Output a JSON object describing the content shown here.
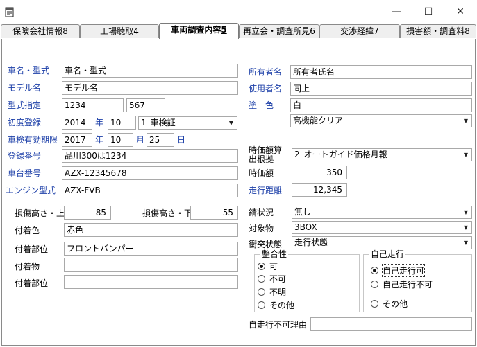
{
  "window": {
    "app_icon": "notepad-icon",
    "minimize_glyph": "—",
    "maximize_glyph": "☐",
    "close_glyph": "✕"
  },
  "tabs": [
    {
      "label": "保険会社情報",
      "key": "8"
    },
    {
      "label": "工場聴取",
      "key": "4"
    },
    {
      "label": "車両調査内容",
      "key": "5"
    },
    {
      "label": "再立会・調査所見",
      "key": "6"
    },
    {
      "label": "交渉経緯",
      "key": "7"
    },
    {
      "label": "損害額・調査料",
      "key": "8"
    }
  ],
  "left": {
    "car_name_label": "車名・型式",
    "car_name_value": "車名・型式",
    "model_label": "モデル名",
    "model_value": "モデル名",
    "type_label": "型式指定",
    "type_value1": "1234",
    "type_value2": "567",
    "first_reg_label": "初度登録",
    "first_reg_year": "2014",
    "year_unit": "年",
    "first_reg_month": "10",
    "first_reg_type": "1_車検証",
    "inspection_label": "車検有効期限",
    "inspection_year": "2017",
    "inspection_month": "10",
    "month_unit": "月",
    "inspection_day": "25",
    "day_unit": "日",
    "reg_no_label": "登録番号",
    "reg_no_value": "品川300は1234",
    "chassis_label": "車台番号",
    "chassis_value": "AZX-12345678",
    "engine_label": "エンジン型式",
    "engine_value": "AZX-FVB",
    "damage_high_label": "損傷高さ・上",
    "damage_high_value": "85",
    "damage_low_label": "損傷高さ・下",
    "damage_low_value": "55",
    "color_label": "付着色",
    "color_value": "赤色",
    "part_label": "付着部位",
    "part_value": "フロントバンパー",
    "object_label": "付着物",
    "object_value": "",
    "part2_label": "付着部位",
    "part2_value": ""
  },
  "right": {
    "owner_label": "所有者名",
    "owner_value": "所有者氏名",
    "user_label": "使用者名",
    "user_value": "同上",
    "paint_label": "塗　色",
    "paint_value": "白",
    "paint_type": "高機能クリア",
    "price_basis_label1": "時価額算",
    "price_basis_label2": "出根拠",
    "price_basis_value": "2_オートガイド価格月報",
    "price_label": "時価額",
    "price_value": "350",
    "mileage_label": "走行距離",
    "mileage_value": "12,345",
    "rust_label": "錆状況",
    "rust_value": "無し",
    "target_label": "対象物",
    "target_value": "3BOX",
    "collision_label": "衝突状態",
    "collision_value": "走行状態",
    "consistency_title": "整合性",
    "consistency_options": [
      "可",
      "不可",
      "不明",
      "その他"
    ],
    "self_drive_title": "自己走行",
    "self_drive_options": [
      "自己走行可",
      "自己走行不可",
      "その他"
    ],
    "no_drive_reason_label": "自走行不可理由",
    "no_drive_reason_value": ""
  }
}
